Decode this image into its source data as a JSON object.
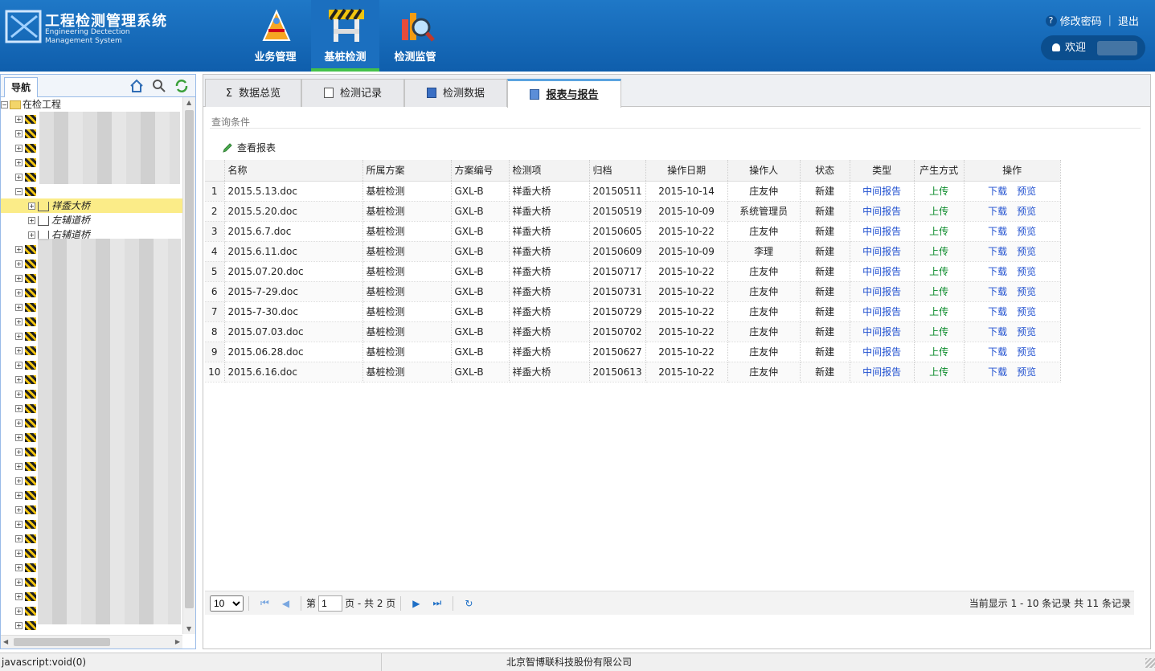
{
  "header": {
    "title": "工程检测管理系统",
    "subtitle_line1": "Engineering Dectection",
    "subtitle_line2": "Management System",
    "nav": [
      {
        "label": "业务管理",
        "icon": "business-management-icon"
      },
      {
        "label": "基桩检测",
        "icon": "pile-detection-icon"
      },
      {
        "label": "检测监管",
        "icon": "detection-supervision-icon"
      }
    ],
    "change_password": "修改密码",
    "logout": "退出",
    "welcome": "欢迎"
  },
  "left_panel": {
    "tab_label": "导航",
    "tools": [
      "home-icon",
      "search-icon",
      "refresh-icon"
    ],
    "root_label": "在检工程",
    "selected_label": "祥盉大桥",
    "child_nodes": [
      "左辅道桥",
      "右辅道桥"
    ]
  },
  "tabs": [
    {
      "label": "数据总览",
      "icon": "sigma-icon"
    },
    {
      "label": "检测记录",
      "icon": "document-icon"
    },
    {
      "label": "检测数据",
      "icon": "save-icon"
    },
    {
      "label": "报表与报告",
      "icon": "book-icon"
    }
  ],
  "query_label": "查询条件",
  "view_report_label": "查看报表",
  "table": {
    "columns": [
      "名称",
      "所属方案",
      "方案编号",
      "检测项",
      "归档",
      "操作日期",
      "操作人",
      "状态",
      "类型",
      "产生方式",
      "操作"
    ],
    "rows": [
      {
        "no": "1",
        "name": "2015.5.13.doc",
        "plan": "基桩检测",
        "code": "GXL-B",
        "item": "祥盉大桥",
        "archive": "20150511",
        "date": "2015-10-14",
        "operator": "庄友仲",
        "status": "新建",
        "type": "中间报告",
        "method": "上传"
      },
      {
        "no": "2",
        "name": "2015.5.20.doc",
        "plan": "基桩检测",
        "code": "GXL-B",
        "item": "祥盉大桥",
        "archive": "20150519",
        "date": "2015-10-09",
        "operator": "系统管理员",
        "status": "新建",
        "type": "中间报告",
        "method": "上传"
      },
      {
        "no": "3",
        "name": "2015.6.7.doc",
        "plan": "基桩检测",
        "code": "GXL-B",
        "item": "祥盉大桥",
        "archive": "20150605",
        "date": "2015-10-22",
        "operator": "庄友仲",
        "status": "新建",
        "type": "中间报告",
        "method": "上传"
      },
      {
        "no": "4",
        "name": "2015.6.11.doc",
        "plan": "基桩检测",
        "code": "GXL-B",
        "item": "祥盉大桥",
        "archive": "20150609",
        "date": "2015-10-09",
        "operator": "李理",
        "status": "新建",
        "type": "中间报告",
        "method": "上传"
      },
      {
        "no": "5",
        "name": "2015.07.20.doc",
        "plan": "基桩检测",
        "code": "GXL-B",
        "item": "祥盉大桥",
        "archive": "20150717",
        "date": "2015-10-22",
        "operator": "庄友仲",
        "status": "新建",
        "type": "中间报告",
        "method": "上传"
      },
      {
        "no": "6",
        "name": "2015-7-29.doc",
        "plan": "基桩检测",
        "code": "GXL-B",
        "item": "祥盉大桥",
        "archive": "20150731",
        "date": "2015-10-22",
        "operator": "庄友仲",
        "status": "新建",
        "type": "中间报告",
        "method": "上传"
      },
      {
        "no": "7",
        "name": "2015-7-30.doc",
        "plan": "基桩检测",
        "code": "GXL-B",
        "item": "祥盉大桥",
        "archive": "20150729",
        "date": "2015-10-22",
        "operator": "庄友仲",
        "status": "新建",
        "type": "中间报告",
        "method": "上传"
      },
      {
        "no": "8",
        "name": "2015.07.03.doc",
        "plan": "基桩检测",
        "code": "GXL-B",
        "item": "祥盉大桥",
        "archive": "20150702",
        "date": "2015-10-22",
        "operator": "庄友仲",
        "status": "新建",
        "type": "中间报告",
        "method": "上传"
      },
      {
        "no": "9",
        "name": "2015.06.28.doc",
        "plan": "基桩检测",
        "code": "GXL-B",
        "item": "祥盉大桥",
        "archive": "20150627",
        "date": "2015-10-22",
        "operator": "庄友仲",
        "status": "新建",
        "type": "中间报告",
        "method": "上传"
      },
      {
        "no": "10",
        "name": "2015.6.16.doc",
        "plan": "基桩检测",
        "code": "GXL-B",
        "item": "祥盉大桥",
        "archive": "20150613",
        "date": "2015-10-22",
        "operator": "庄友仲",
        "status": "新建",
        "type": "中间报告",
        "method": "上传"
      }
    ],
    "op_download": "下载",
    "op_preview": "预览"
  },
  "pager": {
    "page_size": "10",
    "page_prefix": "第",
    "current_page": "1",
    "page_suffix": "页 - 共 2 页",
    "info": "当前显示 1 - 10 条记录 共 11 条记录"
  },
  "status_bar": {
    "left": "javascript:void(0)",
    "center": "北京智博联科技股份有限公司"
  },
  "colors": {
    "header_bg": "#1268b5",
    "active_nav_underline": "#44c14a",
    "link_blue": "#2050d0",
    "link_green": "#0a8a2a"
  }
}
